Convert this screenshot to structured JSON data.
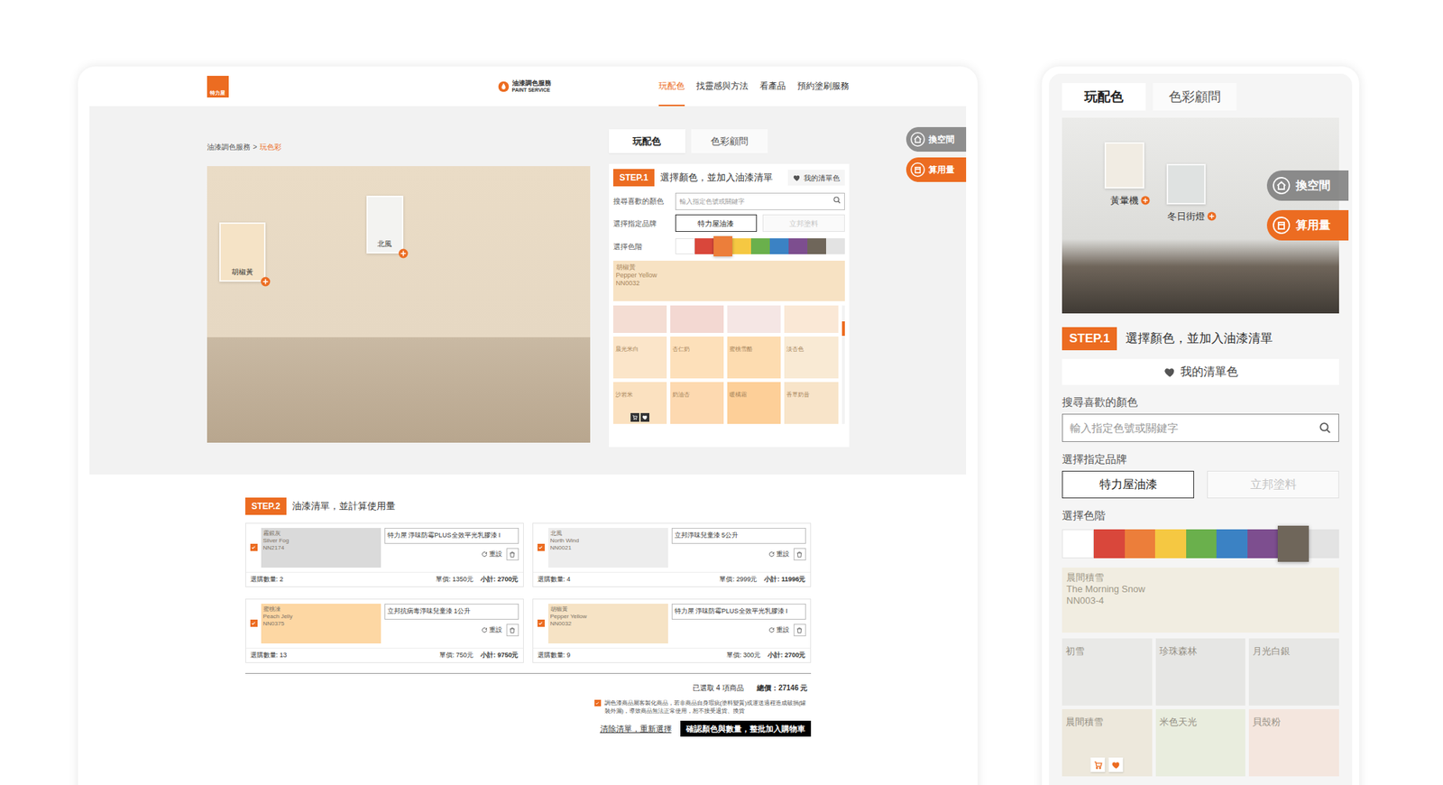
{
  "desktop": {
    "logo": "特力屋",
    "brand": {
      "title": "油漆調色服務",
      "subtitle": "PAINT SERVICE"
    },
    "nav": [
      {
        "label": "玩配色",
        "selected": true
      },
      {
        "label": "找靈感與方法",
        "selected": false
      },
      {
        "label": "看產品",
        "selected": false
      },
      {
        "label": "預約塗刷服務",
        "selected": false
      }
    ],
    "breadcrumb": {
      "items": [
        {
          "label": "油漆調色服務",
          "selected": false
        },
        {
          "label": "玩色彩",
          "selected": true
        }
      ],
      "separator": ">"
    },
    "room": {
      "tags": [
        {
          "label": "胡椒黃",
          "color": "#f5e3c6"
        },
        {
          "label": "北風",
          "color": "#f3f3f1"
        }
      ]
    },
    "side_buttons": [
      {
        "label": "換空間",
        "selected": false
      },
      {
        "label": "算用量",
        "selected": true
      }
    ],
    "panel": {
      "tabs": [
        {
          "label": "玩配色",
          "selected": true
        },
        {
          "label": "色彩顧問",
          "selected": false
        }
      ],
      "step": {
        "badge": "STEP.1",
        "title": "選擇顏色，並加入油漆清單"
      },
      "favorites": "我的清單色",
      "search": {
        "label": "搜尋喜歡的顏色",
        "placeholder": "輸入指定色號或關鍵字"
      },
      "brand": {
        "label": "選擇指定品牌",
        "options": [
          {
            "label": "特力屋油漆",
            "selected": true,
            "disabled": false
          },
          {
            "label": "立邦塗料",
            "selected": false,
            "disabled": true
          }
        ]
      },
      "shades": {
        "label": "選擇色階",
        "items": [
          {
            "color": "#ffffff",
            "selected": false
          },
          {
            "color": "#d9473b",
            "selected": false
          },
          {
            "color": "#ec7e3a",
            "selected": true
          },
          {
            "color": "#f5c842",
            "selected": false
          },
          {
            "color": "#6ab04c",
            "selected": false
          },
          {
            "color": "#3b82c4",
            "selected": false
          },
          {
            "color": "#7d4e8f",
            "selected": false
          },
          {
            "color": "#6f665a",
            "selected": false
          },
          {
            "color": "#e3e3e3",
            "selected": false
          }
        ]
      },
      "featured": {
        "color": "#f7e2c3",
        "lines": [
          "胡椒黃",
          "Pepper Yellow",
          "NN0032"
        ]
      },
      "swatches": [
        {
          "kind": "cut",
          "color": "#f4ddd3",
          "hovered": false
        },
        {
          "kind": "cut",
          "color": "#f3d8d2",
          "hovered": false
        },
        {
          "kind": "cut",
          "color": "#f5e6e4",
          "hovered": false
        },
        {
          "kind": "cut",
          "color": "#fae8d6",
          "hovered": false
        },
        {
          "kind": "named",
          "name": "晨光米白",
          "color": "#fbe5c9",
          "hovered": false
        },
        {
          "kind": "named",
          "name": "杏仁奶",
          "color": "#fde0ba",
          "hovered": false
        },
        {
          "kind": "named",
          "name": "蜜桃雪酪",
          "color": "#fddcb0",
          "hovered": false
        },
        {
          "kind": "named",
          "name": "淡杏色",
          "color": "#f9ead4",
          "hovered": false
        },
        {
          "kind": "named",
          "name": "沙岩米",
          "color": "#fbe1c0",
          "hovered": true
        },
        {
          "kind": "named",
          "name": "奶油杏",
          "color": "#fdd9b0",
          "hovered": false
        },
        {
          "kind": "named",
          "name": "暖橘霜",
          "color": "#fdcf98",
          "hovered": false
        },
        {
          "kind": "named",
          "name": "香草奶昔",
          "color": "#f8e4c9",
          "hovered": false
        }
      ],
      "scroll": {
        "level": 0.15
      }
    },
    "step2": {
      "badge": "STEP.2",
      "title": "油漆清單，並計算使用量",
      "items": [
        {
          "checked": true,
          "color": "#dadada",
          "lines": [
            "霧銀灰",
            "Silver Fog",
            "NN2174"
          ],
          "product": "特力屋 淨味防霉PLUS全效平光乳膠漆 I",
          "reset": "重設",
          "quantity": "選購數量: 2",
          "price": "單價: 1350元",
          "subtotal": "小計: 2700元"
        },
        {
          "checked": true,
          "color": "#ededed",
          "lines": [
            "北風",
            "North Wind",
            "NN0021"
          ],
          "product": "立邦淨味兒童漆 5公升",
          "reset": "重設",
          "quantity": "選購數量: 4",
          "price": "單價: 2999元",
          "subtotal": "小計: 11996元"
        },
        {
          "checked": true,
          "color": "#fdd7a3",
          "lines": [
            "蜜桃凍",
            "Peach Jelly",
            "NN0375"
          ],
          "product": "立邦抗病毒淨味兒童漆 1公升",
          "reset": "重設",
          "quantity": "選購數量: 13",
          "price": "單價: 750元",
          "subtotal": "小計: 9750元"
        },
        {
          "checked": true,
          "color": "#f6e3c5",
          "lines": [
            "胡椒黃",
            "Pepper Yellow",
            "NN0032"
          ],
          "product": "特力屋 淨味防霉PLUS全效平光乳膠漆 I",
          "reset": "重設",
          "quantity": "選購數量: 9",
          "price": "單價: 300元",
          "subtotal": "小計: 2700元"
        }
      ],
      "summary": {
        "count": "已選取 4 項商品",
        "total": "總價：27146 元"
      },
      "notice": {
        "checked": true,
        "text": "調色漆商品屬客製化商品，若非商品自身瑕疵(塗料變質)或運送過程造成破損(罐裝外漏)，導致商品無法正常使用，恕不接受退貨、換貨"
      },
      "clear": "清除清單，重新選擇",
      "submit": "確認顏色與數量，整批加入購物車"
    }
  },
  "mobile": {
    "tabs": [
      {
        "label": "玩配色",
        "selected": true
      },
      {
        "label": "色彩顧問",
        "selected": false
      }
    ],
    "room": {
      "tags": [
        {
          "label": "黃暈機",
          "color": "#f1ece3"
        },
        {
          "label": "冬日街燈",
          "color": "#dfe2e1"
        }
      ]
    },
    "side_buttons": [
      {
        "label": "換空間",
        "selected": false
      },
      {
        "label": "算用量",
        "selected": true
      }
    ],
    "step": {
      "badge": "STEP.1",
      "title": "選擇顏色，並加入油漆清單"
    },
    "favorites": "我的清單色",
    "search": {
      "label": "搜尋喜歡的顏色",
      "placeholder": "輸入指定色號或關鍵字"
    },
    "brand": {
      "label": "選擇指定品牌",
      "options": [
        {
          "label": "特力屋油漆",
          "selected": true,
          "disabled": false
        },
        {
          "label": "立邦塗料",
          "selected": false,
          "disabled": true
        }
      ]
    },
    "shades": {
      "label": "選擇色階",
      "items": [
        {
          "color": "#ffffff",
          "selected": false
        },
        {
          "color": "#d9473b",
          "selected": false
        },
        {
          "color": "#ec7e3a",
          "selected": false
        },
        {
          "color": "#f5c842",
          "selected": false
        },
        {
          "color": "#6ab04c",
          "selected": false
        },
        {
          "color": "#3b82c4",
          "selected": false
        },
        {
          "color": "#7d4e8f",
          "selected": false
        },
        {
          "color": "#6f665a",
          "selected": true
        },
        {
          "color": "#e3e3e3",
          "selected": false
        }
      ]
    },
    "featured": {
      "color": "#f1ede1",
      "lines": [
        "晨間積雪",
        "The Morning Snow",
        "NN003-4"
      ]
    },
    "swatches": [
      {
        "name": "初雪",
        "color": "#e9e9e7",
        "hovered": false
      },
      {
        "name": "珍珠森林",
        "color": "#e6e6e4",
        "hovered": false
      },
      {
        "name": "月光白銀",
        "color": "#e7e7e5",
        "hovered": false
      },
      {
        "name": "晨間積雪",
        "color": "#ede8dc",
        "hovered": true
      },
      {
        "name": "米色天光",
        "color": "#e9edde",
        "hovered": false
      },
      {
        "name": "貝殼粉",
        "color": "#f4e6de",
        "hovered": false
      }
    ]
  }
}
